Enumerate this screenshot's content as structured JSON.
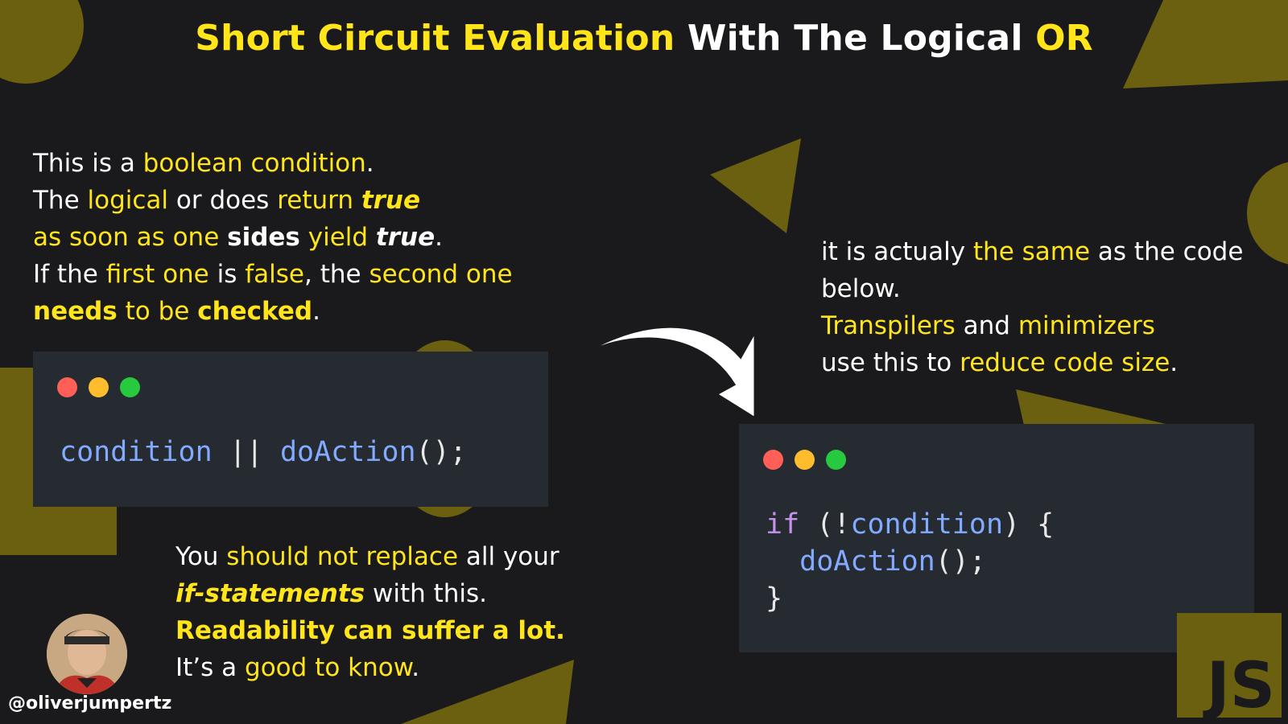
{
  "title": {
    "part1": "Short Circuit Evaluation",
    "part2": " With The Logical ",
    "part3": "OR"
  },
  "left_text": {
    "l1a": "This is a ",
    "l1b": "boolean condition",
    "l1c": ".",
    "l2a": "The ",
    "l2b": "logical",
    "l2c": " or does ",
    "l2d": "return ",
    "l2e": "true",
    "l3a": "as soon as one ",
    "l3b": "sides",
    "l3c": " yield ",
    "l3d": "true",
    "l3e": ".",
    "l4a": "If the ",
    "l4b": "first one",
    "l4c": " is ",
    "l4d": "false",
    "l4e": ", the ",
    "l4f": "second one",
    "l5a": "needs",
    "l5b": " to be ",
    "l5c": "checked",
    "l5d": "."
  },
  "right_text": {
    "l1a": "it is actualy ",
    "l1b": "the same",
    "l1c": " as the code",
    "l2": "below.",
    "l3a": "Transpilers",
    "l3b": " and ",
    "l3c": "minimizers",
    "l4a": "use this to ",
    "l4b": "reduce code size",
    "l4c": "."
  },
  "bottom_text": {
    "l1a": "You ",
    "l1b": "should not replace",
    "l1c": " all your",
    "l2a": "if-statements",
    "l2b": " with this.",
    "l3": "Readability can suffer a lot.",
    "l4a": "It’s a ",
    "l4b": "good to know",
    "l4c": "."
  },
  "code1": {
    "a": "condition",
    "b": " || ",
    "c": "doAction",
    "d": "();"
  },
  "code2": {
    "l1a": "if",
    "l1b": " (!",
    "l1c": "condition",
    "l1d": ") {",
    "l2a": "  ",
    "l2b": "doAction",
    "l2c": "();",
    "l3": "}"
  },
  "author": {
    "handle": "@oliverjumpertz"
  },
  "badge": {
    "label": "JS"
  },
  "colors": {
    "accent": "#ffe51a",
    "background": "#1a1a1d",
    "shape": "#6b5f10",
    "code_bg": "#262a31"
  }
}
